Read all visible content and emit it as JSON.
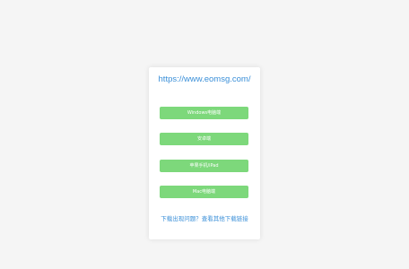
{
  "page": {
    "background_color": "#f5f5f5"
  },
  "card": {
    "site_url": "https://www.eomsg.com/",
    "buttons": [
      {
        "label": "Windows电脑端"
      },
      {
        "label": "安卓端"
      },
      {
        "label": "苹果手机/iPad"
      },
      {
        "label": "Mac电脑端"
      }
    ],
    "help_link": "下载出现问题？查看其他下载链接"
  },
  "colors": {
    "accent_link": "#3a8fd8",
    "button_green": "#7dd87b",
    "card_bg": "#ffffff"
  }
}
